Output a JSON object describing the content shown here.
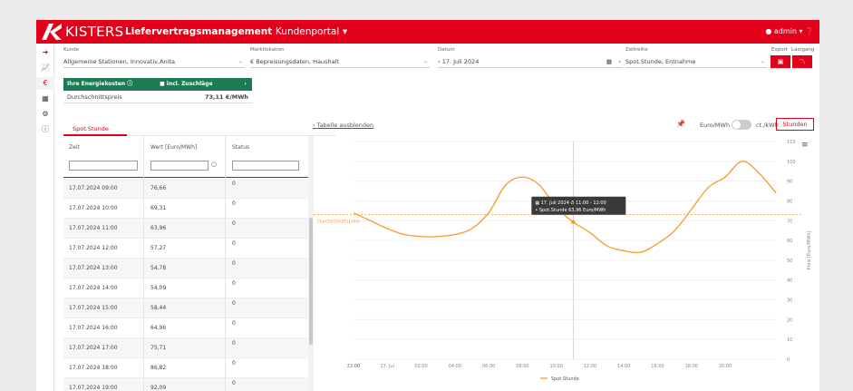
{
  "header": {
    "brand": "KISTERS",
    "app_title": "Liefervertragsmanagement",
    "app_sub": "Kundenportal",
    "user": "admin"
  },
  "filters": {
    "kunde_label": "Kunde",
    "kunde_value": "Allgemeine Stationen, Innovativ,Anita",
    "markt_label": "Marktlokation",
    "markt_value": "Bepreisungsdaten, Haushalt",
    "datum_label": "Datum",
    "datum_value": "17. Juli 2024",
    "zeitreihe_label": "Zeitreihe",
    "zeitreihe_value": "Spot.Stunde, Entnahme",
    "export_label": "Export",
    "lastgang_label": "Lastgang"
  },
  "energy": {
    "header_label": "Ihre Energiekosten",
    "toggle_label": "incl. Zuschläge",
    "row_label": "Durchschnittspreis",
    "row_value": "73,11 €/MWh"
  },
  "tabs": {
    "active": "Spot.Stunde"
  },
  "table": {
    "columns": [
      "Zeit",
      "Wert [Euro/MWh]",
      "Status"
    ],
    "rows": [
      {
        "zeit": "17.07.2024 09:00",
        "wert": "76,66",
        "status": "0"
      },
      {
        "zeit": "17.07.2024 10:00",
        "wert": "69,31",
        "status": "0"
      },
      {
        "zeit": "17.07.2024 11:00",
        "wert": "63,96",
        "status": "0"
      },
      {
        "zeit": "17.07.2024 12:00",
        "wert": "57,27",
        "status": "0"
      },
      {
        "zeit": "17.07.2024 13:00",
        "wert": "54,78",
        "status": "0"
      },
      {
        "zeit": "17.07.2024 14:00",
        "wert": "54,09",
        "status": "0"
      },
      {
        "zeit": "17.07.2024 15:00",
        "wert": "58,44",
        "status": "0"
      },
      {
        "zeit": "17.07.2024 16:00",
        "wert": "64,96",
        "status": "0"
      },
      {
        "zeit": "17.07.2024 17:00",
        "wert": "75,71",
        "status": "0"
      },
      {
        "zeit": "17.07.2024 18:00",
        "wert": "86,82",
        "status": "0"
      },
      {
        "zeit": "17.07.2024 19:00",
        "wert": "92,09",
        "status": "0"
      }
    ]
  },
  "controls": {
    "hide_table": "Tabelle ausblenden",
    "unit_euro": "Euro/MWh",
    "unit_ct": "ct./kWh",
    "stunden": "Stunden"
  },
  "chart_data": {
    "type": "line",
    "x": [
      "22:00",
      "23:00",
      "17. Jul",
      "01:00",
      "02:00",
      "03:00",
      "04:00",
      "05:00",
      "06:00",
      "07:00",
      "08:00",
      "09:00",
      "10:00",
      "11:00",
      "12:00",
      "13:00",
      "14:00",
      "15:00",
      "16:00",
      "17:00",
      "18:00",
      "19:00",
      "20:00",
      "21:00",
      "22:00",
      "23:00"
    ],
    "x_ticks": [
      "22:00",
      "17. Jul",
      "02:00",
      "04:00",
      "06:00",
      "08:00",
      "10:00",
      "12:00",
      "14:00",
      "16:00",
      "18:00",
      "20:00",
      "22:00"
    ],
    "series": [
      {
        "name": "Spot.Stunde",
        "values": [
          74,
          70,
          66,
          63,
          62,
          62,
          63,
          66,
          74,
          88,
          92,
          88,
          76.66,
          69.31,
          63.96,
          57.27,
          54.78,
          54.09,
          58.44,
          64.96,
          75.71,
          86.82,
          92.09,
          100,
          94,
          84
        ]
      }
    ],
    "average": 73.11,
    "average_label": "Durchschnittspreis",
    "ylabel": "Preis [Euro/MWh]",
    "ylim": [
      0,
      110
    ],
    "y_ticks": [
      0,
      10,
      20,
      30,
      40,
      50,
      60,
      70,
      80,
      90,
      100,
      110
    ],
    "tooltip": {
      "date": "17. Juli 2024",
      "time": "11:00 - 12:00",
      "series": "Spot.Stunde",
      "value": "63,96 Euro/MWh"
    },
    "legend": "Spot.Stunde",
    "legend_position": "bottom"
  }
}
